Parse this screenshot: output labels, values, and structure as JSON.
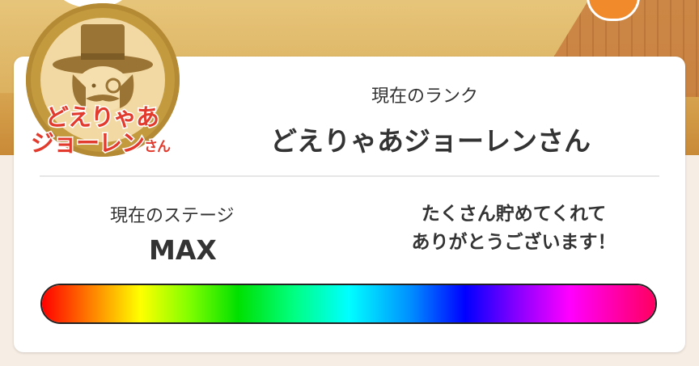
{
  "rank": {
    "label": "現在のランク",
    "name": "どえりゃあジョーレンさん",
    "badge": {
      "line1": "どえりゃあ",
      "line2_main": "ジョーレン",
      "line2_small": "さん",
      "icon": "gentleman-top-hat-icon"
    }
  },
  "stage": {
    "label": "現在のステージ",
    "value": "MAX",
    "progress": 1.0
  },
  "message": {
    "line1": "たくさん貯めてくれて",
    "line2": "ありがとうございます！"
  },
  "colors": {
    "badge_text": "#e23b2e",
    "card_bg": "#ffffff",
    "text": "#333333"
  }
}
